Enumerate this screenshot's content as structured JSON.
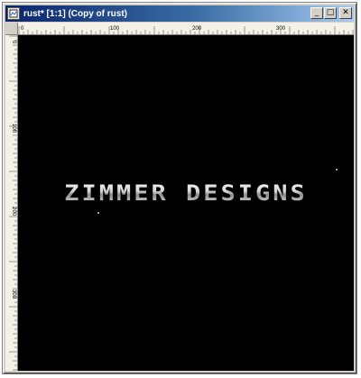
{
  "window": {
    "title": "rust* [1:1] (Copy of rust)",
    "buttons": {
      "minimize_glyph": "_",
      "maximize_glyph": "□",
      "close_glyph": "✕"
    }
  },
  "ruler": {
    "h_labels": [
      "0",
      "100",
      "200",
      "300"
    ],
    "v_labels": [
      "0",
      "100",
      "200",
      "300"
    ]
  },
  "canvas": {
    "background_color": "#000000",
    "text": "ZIMMER DESIGNS",
    "text_style": "chrome"
  },
  "colors": {
    "title_bar_start": "#0a246a",
    "title_bar_end": "#a6caf0",
    "frame": "#d4d0c8"
  }
}
